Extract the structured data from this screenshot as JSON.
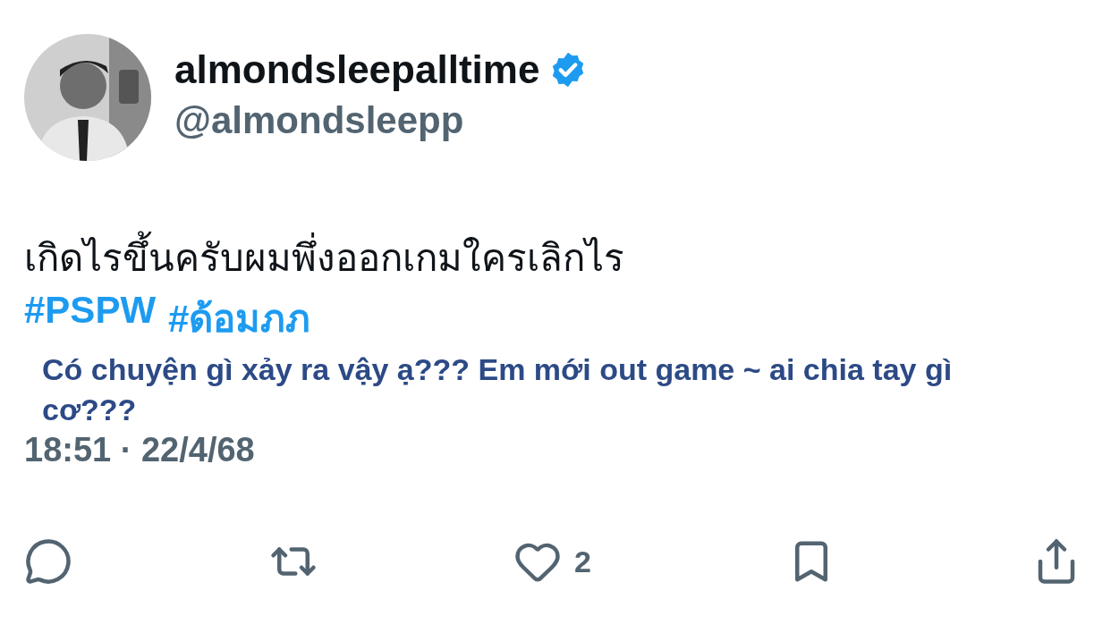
{
  "author": {
    "display_name": "almondsleepalltime",
    "handle": "@almondsleepp",
    "verified": true
  },
  "tweet": {
    "text": "เกิดไรขึ้นครับผมพึ่งออกเกมใครเลิกไร",
    "hashtags": [
      "#PSPW",
      "#ด้อมภภ"
    ],
    "translation": "Có chuyện gì xảy ra vậy ạ???  Em mới out game ~ ai chia tay gì cơ???",
    "timestamp": "18:51 · 22/4/68"
  },
  "actions": [
    {
      "kind": "reply"
    },
    {
      "kind": "repost"
    },
    {
      "kind": "like",
      "count": "2"
    },
    {
      "kind": "bookmark"
    },
    {
      "kind": "share"
    }
  ]
}
